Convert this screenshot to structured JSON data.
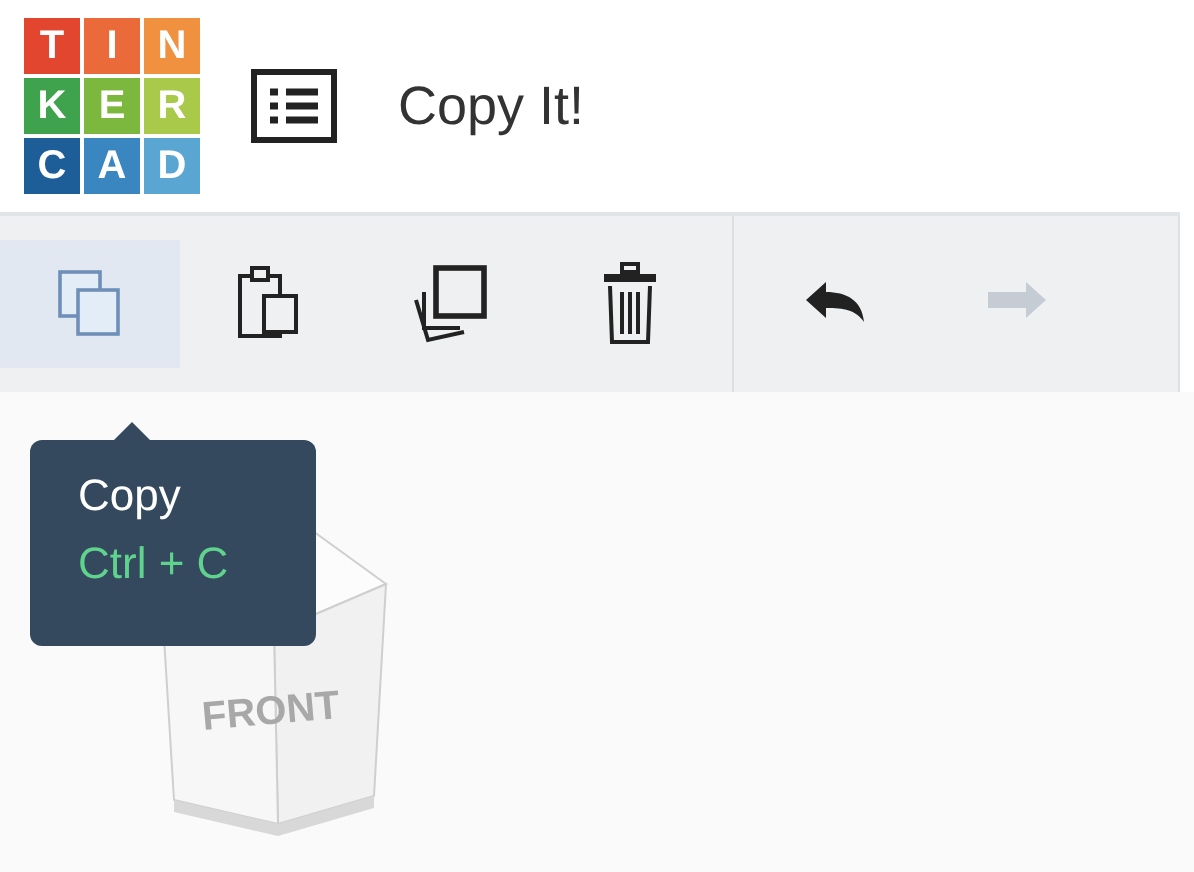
{
  "logo": {
    "tiles": [
      {
        "letter": "T",
        "color": "#e2462f"
      },
      {
        "letter": "I",
        "color": "#ea6a3a"
      },
      {
        "letter": "N",
        "color": "#f0913f"
      },
      {
        "letter": "K",
        "color": "#3fa34d"
      },
      {
        "letter": "E",
        "color": "#7cb83e"
      },
      {
        "letter": "R",
        "color": "#a9c94a"
      },
      {
        "letter": "C",
        "color": "#1d5e99"
      },
      {
        "letter": "A",
        "color": "#3a86c0"
      },
      {
        "letter": "D",
        "color": "#5aa6d3"
      }
    ]
  },
  "design_title": "Copy It!",
  "toolbar": {
    "tools": [
      {
        "kind": "copy",
        "hovered": true,
        "disabled": false
      },
      {
        "kind": "paste",
        "hovered": false,
        "disabled": false
      },
      {
        "kind": "duplicate",
        "hovered": false,
        "disabled": false
      },
      {
        "kind": "delete",
        "hovered": false,
        "disabled": false
      },
      {
        "kind": "undo",
        "hovered": false,
        "disabled": false
      },
      {
        "kind": "redo",
        "hovered": false,
        "disabled": true
      }
    ]
  },
  "tooltip": {
    "title": "Copy",
    "shortcut": "Ctrl + C"
  },
  "view_cube": {
    "face_label": "FRONT"
  }
}
